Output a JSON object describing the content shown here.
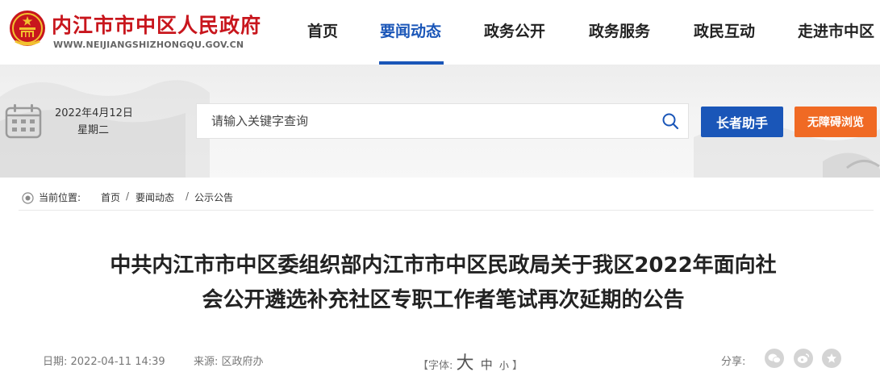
{
  "site": {
    "title": "内江市市中区人民政府",
    "url": "WWW.NEIJIANGSHIZHONGQU.GOV.CN"
  },
  "nav": {
    "items": [
      {
        "label": "首页"
      },
      {
        "label": "要闻动态",
        "active": true
      },
      {
        "label": "政务公开"
      },
      {
        "label": "政务服务"
      },
      {
        "label": "政民互动"
      },
      {
        "label": "走进市中区"
      }
    ]
  },
  "banner": {
    "date": "2022年4月12日",
    "weekday": "星期二",
    "search_placeholder": "请输入关键字查询",
    "elder_label": "长者助手",
    "access_label": "无障碍浏览"
  },
  "breadcrumb": {
    "label": "当前位置:",
    "items": [
      "首页",
      "要闻动态",
      "公示公告"
    ],
    "separator": "/"
  },
  "article": {
    "title_line1": "中共内江市市中区委组织部内江市市中区民政局关于我区2022年面向社",
    "title_line2": "会公开遴选补充社区专职工作者笔试再次延期的公告",
    "date": "日期: 2022-04-11 14:39",
    "source": "来源: 区政府办",
    "font_label_open": "【字体:",
    "font_large": "大",
    "font_medium": "中",
    "font_small": "小",
    "font_label_close": "】",
    "share_label": "分享:"
  },
  "colors": {
    "brand_red": "#c8161d",
    "primary_blue": "#1a56b8",
    "accent_orange": "#f06a24"
  },
  "icons": [
    "national-emblem-icon",
    "calendar-icon",
    "search-icon",
    "location-icon",
    "wechat-icon",
    "weibo-icon",
    "favorite-icon"
  ]
}
